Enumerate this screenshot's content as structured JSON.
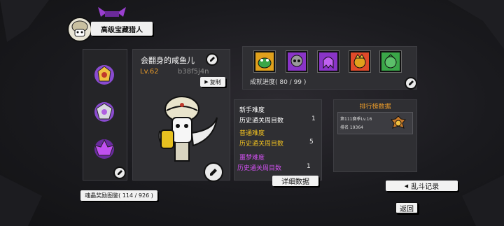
{
  "header": {
    "title": "高级宝藏猎人"
  },
  "profile": {
    "name": "会翻身的咸鱼儿",
    "level": "Lv.62",
    "id": "b38f5j4n",
    "copy_label": "复制"
  },
  "achievements": {
    "progress": "成就进度( 80 / 99 )",
    "icon_colors": [
      "#3aa648",
      "#6b6b6b",
      "#8a34c8",
      "#e0a11c",
      "#3fae4c"
    ]
  },
  "stats": {
    "normal": {
      "title": "新手难度",
      "label": "历史通关周目数",
      "value": "1"
    },
    "hard": {
      "title": "普通难度",
      "label": "历史通关周目数",
      "value": "5"
    },
    "nightmare": {
      "title": "噩梦难度",
      "label": "历史通关周目数",
      "value": "1"
    },
    "detail_button": "详细数据"
  },
  "leaderboard": {
    "title": "排行榜数据",
    "season": "第111赛季Lv.16",
    "rank": "排名 19364"
  },
  "brawl_button": "乱斗记录",
  "medal_collection": "魂晶奖励图鉴( 114 / 926 )",
  "back_button": "返回",
  "colors": {
    "accent_yellow": "#f0c020",
    "nightmare_purple": "#d050f0",
    "accent_orange": "#e89a2a"
  }
}
